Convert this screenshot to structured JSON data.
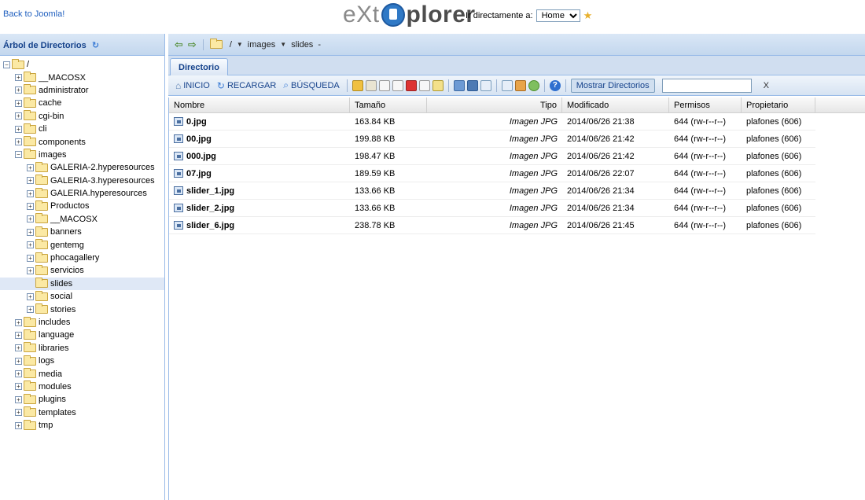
{
  "header": {
    "back_link": "Back to Joomla!",
    "logo_left": "eXt",
    "logo_right": "plorer",
    "goto_label": "Ir directamente a:",
    "goto_value": "Home"
  },
  "tree": {
    "title": "Árbol de Directorios",
    "nodes": [
      {
        "label": "/",
        "depth": 0,
        "expanded": true
      },
      {
        "label": "__MACOSX",
        "depth": 1
      },
      {
        "label": "administrator",
        "depth": 1
      },
      {
        "label": "cache",
        "depth": 1
      },
      {
        "label": "cgi-bin",
        "depth": 1
      },
      {
        "label": "cli",
        "depth": 1
      },
      {
        "label": "components",
        "depth": 1
      },
      {
        "label": "images",
        "depth": 1,
        "expanded": true
      },
      {
        "label": "GALERIA-2.hyperesources",
        "depth": 2
      },
      {
        "label": "GALERIA-3.hyperesources",
        "depth": 2
      },
      {
        "label": "GALERIA.hyperesources",
        "depth": 2
      },
      {
        "label": "Productos",
        "depth": 2
      },
      {
        "label": "__MACOSX",
        "depth": 2
      },
      {
        "label": "banners",
        "depth": 2
      },
      {
        "label": "gentemg",
        "depth": 2
      },
      {
        "label": "phocagallery",
        "depth": 2
      },
      {
        "label": "servicios",
        "depth": 2
      },
      {
        "label": "slides",
        "depth": 2,
        "selected": true,
        "leaf": true
      },
      {
        "label": "social",
        "depth": 2
      },
      {
        "label": "stories",
        "depth": 2
      },
      {
        "label": "includes",
        "depth": 1
      },
      {
        "label": "language",
        "depth": 1
      },
      {
        "label": "libraries",
        "depth": 1
      },
      {
        "label": "logs",
        "depth": 1
      },
      {
        "label": "media",
        "depth": 1
      },
      {
        "label": "modules",
        "depth": 1
      },
      {
        "label": "plugins",
        "depth": 1
      },
      {
        "label": "templates",
        "depth": 1
      },
      {
        "label": "tmp",
        "depth": 1
      }
    ]
  },
  "path": {
    "root": "/",
    "segments": [
      "images",
      "slides"
    ]
  },
  "tabs": {
    "directory": "Directorio"
  },
  "toolbar": {
    "home_label": "INICIO",
    "reload_label": "RECARGAR",
    "search_label": "BÚSQUEDA",
    "show_dirs_label": "Mostrar Directorios",
    "filter_value": "",
    "clear_label": "X"
  },
  "grid": {
    "columns": [
      "Nombre",
      "Tamaño",
      "Tipo",
      "Modificado",
      "Permisos",
      "Propietario"
    ],
    "rows": [
      {
        "name": "0.jpg",
        "size": "163.84 KB",
        "type": "Imagen JPG",
        "modified": "2014/06/26 21:38",
        "perms": "644 (rw-r--r--)",
        "owner": "plafones (606)"
      },
      {
        "name": "00.jpg",
        "size": "199.88 KB",
        "type": "Imagen JPG",
        "modified": "2014/06/26 21:42",
        "perms": "644 (rw-r--r--)",
        "owner": "plafones (606)"
      },
      {
        "name": "000.jpg",
        "size": "198.47 KB",
        "type": "Imagen JPG",
        "modified": "2014/06/26 21:42",
        "perms": "644 (rw-r--r--)",
        "owner": "plafones (606)"
      },
      {
        "name": "07.jpg",
        "size": "189.59 KB",
        "type": "Imagen JPG",
        "modified": "2014/06/26 22:07",
        "perms": "644 (rw-r--r--)",
        "owner": "plafones (606)"
      },
      {
        "name": "slider_1.jpg",
        "size": "133.66 KB",
        "type": "Imagen JPG",
        "modified": "2014/06/26 21:34",
        "perms": "644 (rw-r--r--)",
        "owner": "plafones (606)"
      },
      {
        "name": "slider_2.jpg",
        "size": "133.66 KB",
        "type": "Imagen JPG",
        "modified": "2014/06/26 21:34",
        "perms": "644 (rw-r--r--)",
        "owner": "plafones (606)"
      },
      {
        "name": "slider_6.jpg",
        "size": "238.78 KB",
        "type": "Imagen JPG",
        "modified": "2014/06/26 21:45",
        "perms": "644 (rw-r--r--)",
        "owner": "plafones (606)"
      }
    ]
  }
}
